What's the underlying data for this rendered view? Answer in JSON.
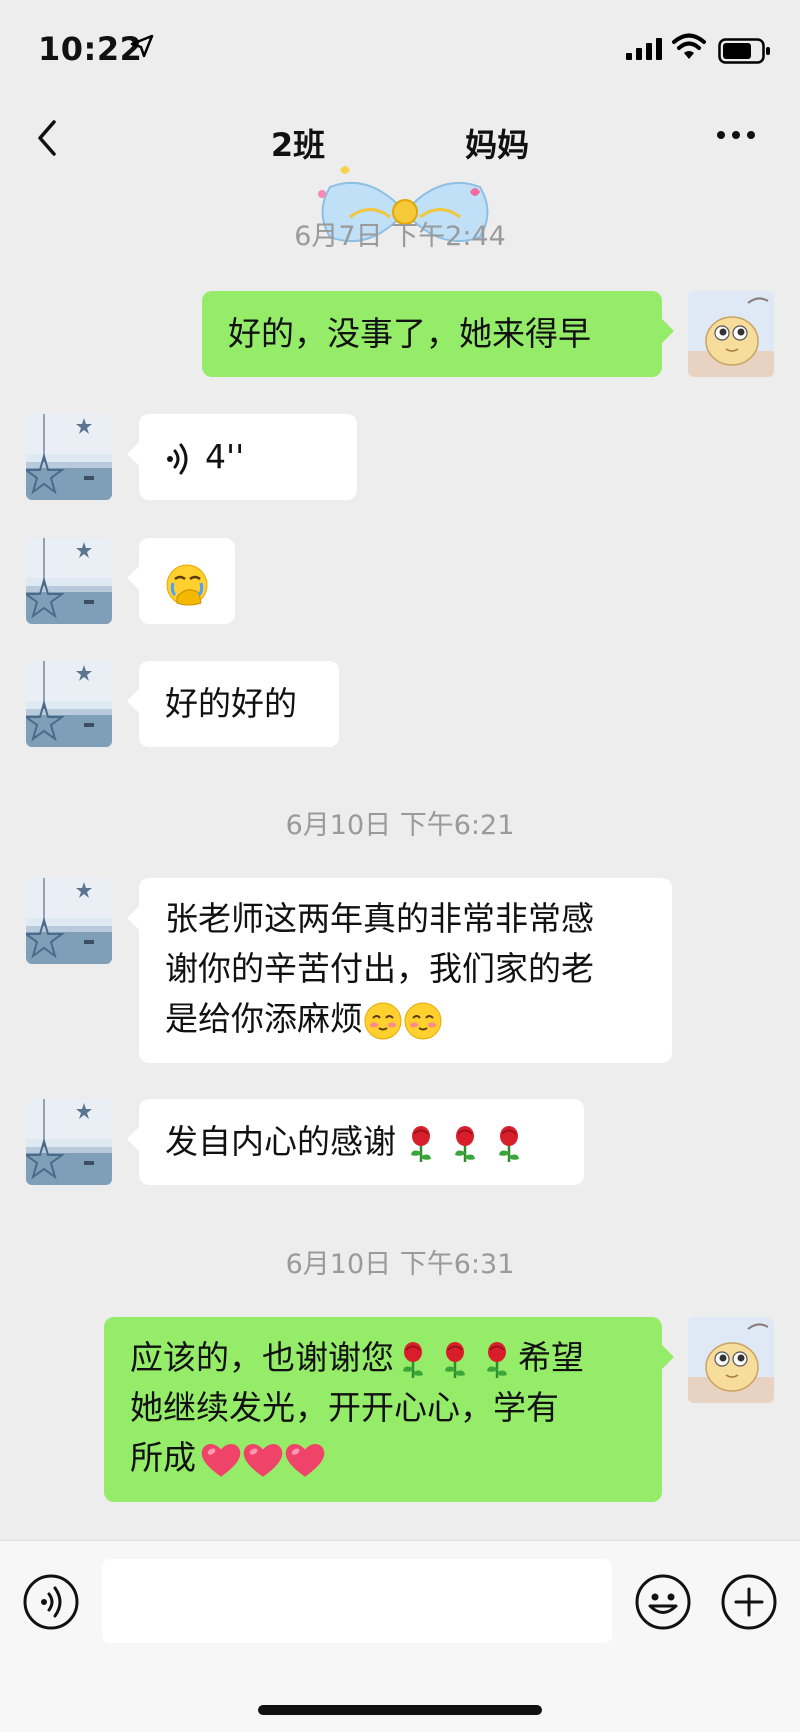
{
  "status": {
    "time": "10:22"
  },
  "header": {
    "title_left": "2班",
    "title_right": "妈妈"
  },
  "messages": {
    "ts1": "6月7日 下午2:44",
    "m1": "好的，没事了，她来得早",
    "voice_duration": "4''",
    "m3": "好的好的",
    "ts2": "6月10日 下午6:21",
    "m4_l1": "张老师这两年真的非常非常感",
    "m4_l2": "谢你的辛苦付出，我们家的老",
    "m4_l3": "是给你添麻烦",
    "m5": "发自内心的感谢",
    "ts3": "6月10日 下午6:31",
    "m6_l1a": "应该的，也谢谢您",
    "m6_l1b": "希望",
    "m6_l2": "她继续发光，开开心心，学有",
    "m6_l3": "所成"
  },
  "icons": {
    "back": "chevron-left-icon",
    "more": "more-icon",
    "voice": "voice-icon",
    "emoji": "emoji-icon",
    "plus": "plus-icon",
    "rose": "rose-emoji",
    "heart": "heart-emoji",
    "blush": "blush-emoji",
    "facepalm": "facepalm-emoji"
  },
  "colors": {
    "sent_bubble": "#95ec69",
    "received_bubble": "#ffffff",
    "background": "#ededed"
  }
}
